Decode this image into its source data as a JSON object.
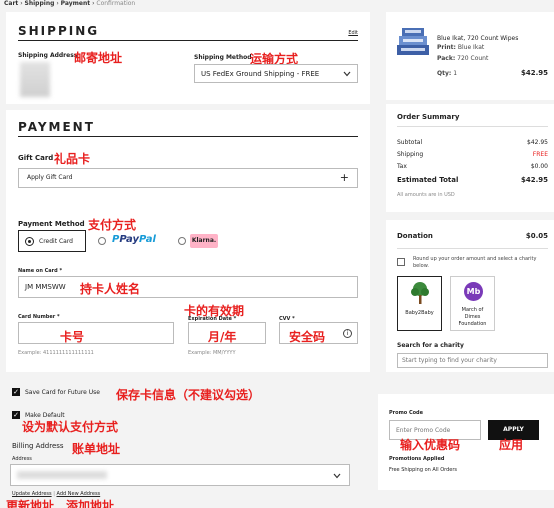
{
  "breadcrumb": {
    "cart": "Cart",
    "shipping": "Shipping",
    "payment": "Payment",
    "confirmation": "Confirmation",
    "sep": "›"
  },
  "shipping": {
    "title": "SHIPPING",
    "edit": "Edit",
    "address_label": "Shipping Address",
    "address_note": "邮寄地址",
    "method_label": "Shipping Method",
    "method_note": "运输方式",
    "method_value": "US FedEx Ground Shipping - FREE"
  },
  "payment": {
    "title": "PAYMENT",
    "gift_label": "Gift Card",
    "gift_note": "礼品卡",
    "gift_button": "Apply Gift Card",
    "method_label": "Payment Method",
    "method_note": "支付方式",
    "credit_card": "Credit Card",
    "paypal_p": "P",
    "paypal_pay": "Pay",
    "paypal_pal": "Pal",
    "klarna": "Klarna.",
    "name_label": "Name on Card *",
    "name_value": "JM MMSWW",
    "name_note": "持卡人姓名",
    "card_label": "Card Number *",
    "card_note": "卡号",
    "card_example": "Example: 4111111111111111",
    "expiry_note": "卡的有效期",
    "expiry_label": "Expiration Date *",
    "expiry_field_note": "月/年",
    "expiry_example": "Example: MM/YYYY",
    "cvv_label": "CVV *",
    "cvv_note": "安全码",
    "info_glyph": "i"
  },
  "save": {
    "save_card": "Save Card for Future Use",
    "save_note": "保存卡信息（不建议勾选）",
    "make_default": "Make Default",
    "default_note": "设为默认支付方式",
    "billing_label": "Billing Address",
    "billing_note": "账单地址",
    "address_sub": "Address",
    "update_link": "Update Address",
    "add_link": "Add New Address",
    "link_sep": "|",
    "update_note": "更新地址",
    "add_note": "添加地址",
    "check_glyph": "✓"
  },
  "product": {
    "name": "Blue Ikat, 720 Count Wipes",
    "print_label": "Print:",
    "print_value": "Blue Ikat",
    "pack_label": "Pack:",
    "pack_value": "720 Count",
    "qty_label": "Qty:",
    "qty_value": "1",
    "price": "$42.95"
  },
  "summary": {
    "title": "Order Summary",
    "rows": [
      {
        "label": "Subtotal",
        "value": "$42.95"
      },
      {
        "label": "Shipping",
        "value": "FREE"
      },
      {
        "label": "Tax",
        "value": "$0.00"
      }
    ],
    "total_label": "Estimated Total",
    "total_value": "$42.95",
    "currency_note": "All amounts are in USD"
  },
  "donation": {
    "title": "Donation",
    "amount": "$0.05",
    "roundup": "Round up your order amount and select a charity below.",
    "charities": [
      "Baby2Baby",
      "March of Dimes Foundation"
    ],
    "mod_logo": "Mb",
    "search_label": "Search for a charity",
    "search_placeholder": "Start typing to find your charity"
  },
  "promo": {
    "label": "Promo Code",
    "placeholder": "Enter Promo Code",
    "apply": "APPLY",
    "input_note": "输入优惠码",
    "apply_note": "应用",
    "applied_label": "Promotions Applied",
    "applied_value": "Free Shipping on All Orders"
  },
  "colors": {
    "accent": "#e8201f",
    "dark": "#111111",
    "paypal_blue": "#253b80",
    "paypal_light": "#179bd7",
    "klarna_pink": "#ffb3c7"
  }
}
